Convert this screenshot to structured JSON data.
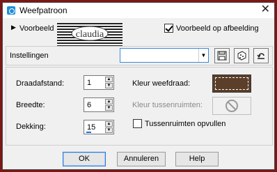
{
  "window": {
    "title": "Weefpatroon",
    "colors": {
      "frame_background": "#7a1818",
      "accent": "#1f8fd6"
    }
  },
  "preview": {
    "toggle_label": "Voorbeeld",
    "logo_text": "claudia",
    "preview_on_image_label": "Voorbeeld op afbeelding",
    "preview_on_image_checked": true
  },
  "presets": {
    "label": "Instellingen",
    "selected_value": ""
  },
  "params": {
    "gap_size": {
      "label": "Draadafstand:",
      "value": "1"
    },
    "width": {
      "label": "Breedte:",
      "value": "6"
    },
    "opacity": {
      "label": "Dekking:",
      "value": "15"
    },
    "weave_color": {
      "label": "Kleur weefdraad:",
      "color": "#5b3f2a"
    },
    "gap_color": {
      "label": "Kleur tussenruimten:"
    },
    "fill_gaps": {
      "label": "Tussenruimten opvullen",
      "checked": false
    }
  },
  "buttons": {
    "ok": "OK",
    "cancel": "Annuleren",
    "help": "Help"
  }
}
